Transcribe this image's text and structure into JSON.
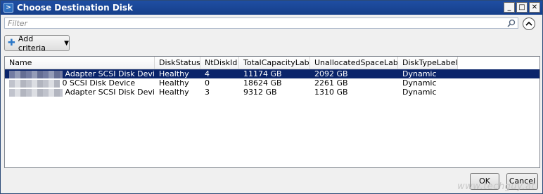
{
  "window": {
    "title": "Choose Destination Disk",
    "minimize": "_",
    "maximize": "□",
    "close": "✕"
  },
  "filter": {
    "placeholder": "Filter",
    "value": ""
  },
  "add_criteria": {
    "label": "Add criteria"
  },
  "columns": [
    "Name",
    "DiskStatus",
    "NtDiskId",
    "TotalCapacityLabel",
    "UnallocatedSpaceLabel",
    "DiskTypeLabel"
  ],
  "rows": [
    {
      "name": "Adapter SCSI Disk Device",
      "status": "Healthy",
      "id": "4",
      "total": "11174 GB",
      "unalloc": "2092 GB",
      "type": "Dynamic",
      "selected": true
    },
    {
      "name": "0 SCSI Disk Device",
      "status": "Healthy",
      "id": "0",
      "total": "18624 GB",
      "unalloc": "2261 GB",
      "type": "Dynamic",
      "selected": false
    },
    {
      "name": "Adapter SCSI Disk Device",
      "status": "Healthy",
      "id": "3",
      "total": "9312 GB",
      "unalloc": "1310 GB",
      "type": "Dynamic",
      "selected": false
    }
  ],
  "buttons": {
    "ok": "OK",
    "cancel": "Cancel"
  },
  "watermark": "www.techguy.at",
  "colors": {
    "title_bar": "#1f4ea3",
    "selection": "#0a246a"
  }
}
